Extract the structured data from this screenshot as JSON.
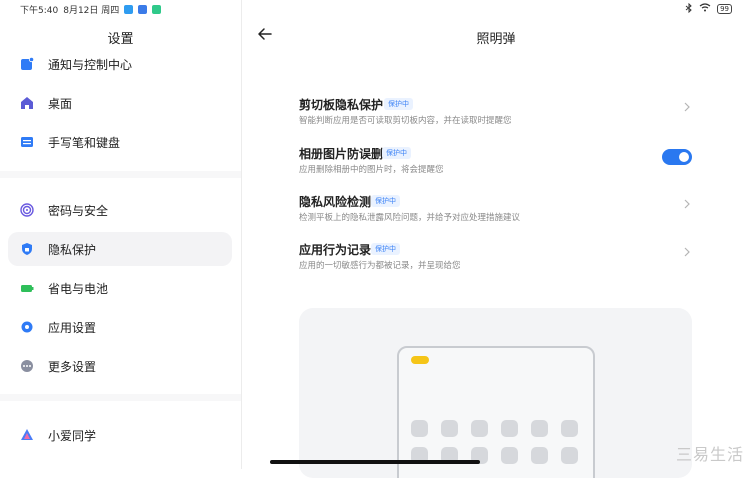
{
  "status": {
    "time": "下午5:40",
    "date": "8月12日 周四",
    "battery": "99"
  },
  "sidebar": {
    "title": "设置",
    "items": [
      {
        "label": "通知与控制中心",
        "icon": "notification-icon",
        "color": "#2f7bf6"
      },
      {
        "label": "桌面",
        "icon": "home-icon",
        "color": "#5b5bd6"
      },
      {
        "label": "手写笔和键盘",
        "icon": "keyboard-icon",
        "color": "#2f7bf6"
      },
      {
        "label": "密码与安全",
        "icon": "fingerprint-icon",
        "color": "#6a5ae0"
      },
      {
        "label": "隐私保护",
        "icon": "privacy-shield-icon",
        "color": "#2f7bf6"
      },
      {
        "label": "省电与电池",
        "icon": "battery-icon",
        "color": "#2fbf5a"
      },
      {
        "label": "应用设置",
        "icon": "gear-icon",
        "color": "#2f7bf6"
      },
      {
        "label": "更多设置",
        "icon": "more-icon",
        "color": "#8a8fa0"
      },
      {
        "label": "小爱同学",
        "icon": "xiaoai-icon",
        "color": "#4a7cf7"
      }
    ]
  },
  "main": {
    "title": "照明弹",
    "settings": [
      {
        "title": "剪切板隐私保护",
        "badge": "保护中",
        "desc": "智能判断应用是否可读取剪切板内容，并在读取时提醒您"
      },
      {
        "title": "相册图片防误删",
        "badge": "保护中",
        "desc": "应用删除相册中的图片时，将会提醒您"
      },
      {
        "title": "隐私风险检测",
        "badge": "保护中",
        "desc": "检测平板上的隐私泄露风险问题，并给予对应处理措施建议"
      },
      {
        "title": "应用行为记录",
        "badge": "保护中",
        "desc": "应用的一切敏感行为都被记录，并呈现给您"
      }
    ],
    "toggle_on": true
  },
  "watermark": "三易生活",
  "colors": {
    "accent": "#2a78f0",
    "badge_text": "#3b82f6",
    "badge_bg": "#eaf2ff"
  }
}
